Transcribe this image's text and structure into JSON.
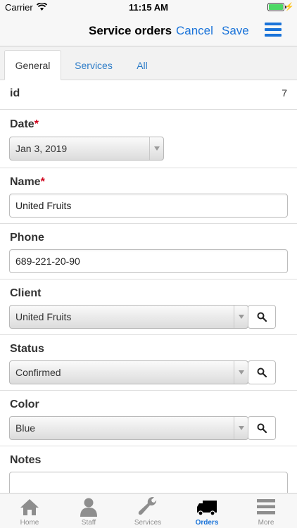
{
  "status_bar": {
    "carrier": "Carrier",
    "time": "11:15 AM"
  },
  "nav": {
    "title": "Service orders",
    "cancel_label": "Cancel",
    "save_label": "Save",
    "accent_color": "#1a73d9"
  },
  "tabs": [
    {
      "label": "General",
      "active": true
    },
    {
      "label": "Services",
      "active": false
    },
    {
      "label": "All",
      "active": false
    }
  ],
  "form": {
    "id": {
      "label": "id",
      "value": "7"
    },
    "date": {
      "label": "Date",
      "required_mark": "*",
      "value": "Jan 3, 2019"
    },
    "name": {
      "label": "Name",
      "required_mark": "*",
      "value": "United Fruits"
    },
    "phone": {
      "label": "Phone",
      "value": "689-221-20-90"
    },
    "client": {
      "label": "Client",
      "value": "United Fruits"
    },
    "status": {
      "label": "Status",
      "value": "Confirmed"
    },
    "color": {
      "label": "Color",
      "value": "Blue"
    },
    "notes": {
      "label": "Notes",
      "value": ""
    }
  },
  "bottom_tabs": [
    {
      "label": "Home",
      "icon": "home-icon",
      "active": false
    },
    {
      "label": "Staff",
      "icon": "person-icon",
      "active": false
    },
    {
      "label": "Services",
      "icon": "wrench-icon",
      "active": false
    },
    {
      "label": "Orders",
      "icon": "truck-icon",
      "active": true
    },
    {
      "label": "More",
      "icon": "menu-icon",
      "active": false
    }
  ]
}
